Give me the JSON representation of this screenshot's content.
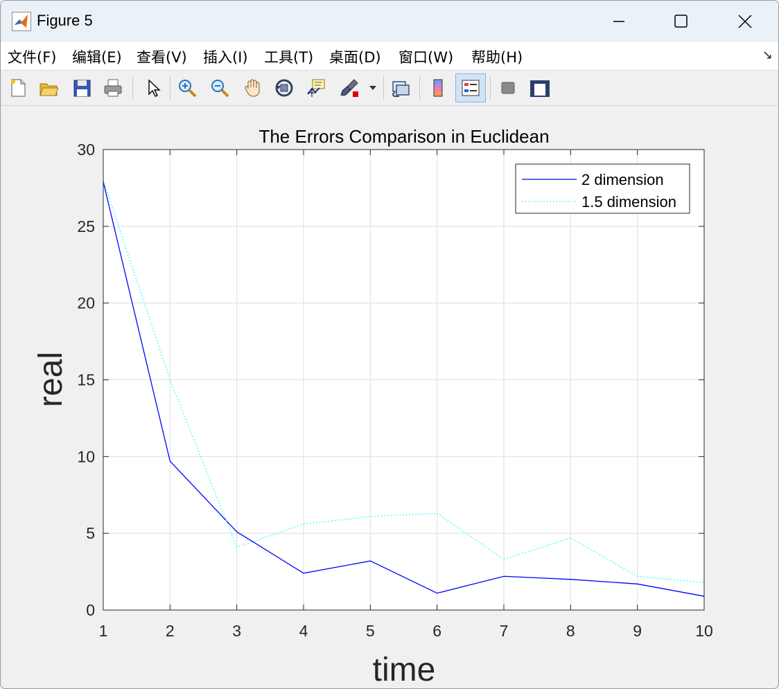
{
  "window": {
    "title": "Figure 5"
  },
  "menu": {
    "items": [
      "文件(F)",
      "编辑(E)",
      "查看(V)",
      "插入(I)",
      "工具(T)",
      "桌面(D)",
      "窗口(W)",
      "帮助(H)"
    ],
    "more": "↘"
  },
  "toolbar": {
    "buttons": [
      "new-figure-icon",
      "open-folder-icon",
      "save-icon",
      "print-icon",
      "select-arrow-icon",
      "zoom-in-icon",
      "zoom-out-icon",
      "pan-hand-icon",
      "rotate-3d-icon",
      "data-cursor-icon",
      "brush-icon",
      "link-plot-icon",
      "colorbar-icon",
      "legend-icon",
      "hide-plot-tools-icon",
      "show-plot-tools-icon"
    ]
  },
  "chart_data": {
    "type": "line",
    "title": "The Errors Comparison in Euclidean",
    "xlabel": "time",
    "ylabel": "real",
    "xlim": [
      1,
      10
    ],
    "ylim": [
      0,
      30
    ],
    "xticks": [
      "1",
      "2",
      "3",
      "4",
      "5",
      "6",
      "7",
      "8",
      "9",
      "10"
    ],
    "yticks": [
      "0",
      "5",
      "10",
      "15",
      "20",
      "25",
      "30"
    ],
    "grid": true,
    "legend_position": "top-right",
    "x": [
      1,
      2,
      3,
      4,
      5,
      6,
      7,
      8,
      9,
      10
    ],
    "series": [
      {
        "name": "2 dimension",
        "color": "#0000ff",
        "style": "solid",
        "values": [
          27.9,
          9.7,
          5.1,
          2.4,
          3.2,
          1.1,
          2.2,
          2.0,
          1.7,
          0.9
        ]
      },
      {
        "name": "1.5 dimension",
        "color": "#00ffff",
        "style": "dotted",
        "values": [
          28.0,
          15.0,
          4.1,
          5.6,
          6.1,
          6.3,
          3.3,
          4.7,
          2.2,
          1.8
        ]
      }
    ]
  }
}
